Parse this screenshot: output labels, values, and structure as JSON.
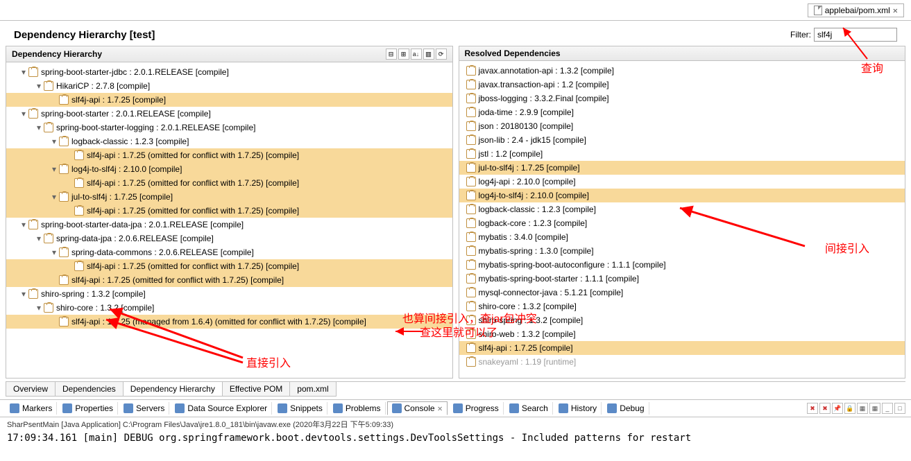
{
  "tab": {
    "label": "applebai/pom.xml",
    "close": "✕"
  },
  "page_title": "Dependency Hierarchy [test]",
  "filter": {
    "label": "Filter:",
    "value": "slf4j"
  },
  "left": {
    "title": "Dependency Hierarchy",
    "tree": [
      {
        "indent": 0,
        "twisty": "▾",
        "text": "spring-boot-starter-jdbc : 2.0.1.RELEASE [compile]",
        "hl": false
      },
      {
        "indent": 1,
        "twisty": "▾",
        "text": "HikariCP : 2.7.8 [compile]",
        "hl": false
      },
      {
        "indent": 2,
        "twisty": "",
        "text": "slf4j-api : 1.7.25 [compile]",
        "hl": true
      },
      {
        "indent": 0,
        "twisty": "▾",
        "text": "spring-boot-starter : 2.0.1.RELEASE [compile]",
        "hl": false
      },
      {
        "indent": 1,
        "twisty": "▾",
        "text": "spring-boot-starter-logging : 2.0.1.RELEASE [compile]",
        "hl": false
      },
      {
        "indent": 2,
        "twisty": "▾",
        "text": "logback-classic : 1.2.3 [compile]",
        "hl": false
      },
      {
        "indent": 3,
        "twisty": "",
        "text": "slf4j-api : 1.7.25 (omitted for conflict with 1.7.25) [compile]",
        "hl": true
      },
      {
        "indent": 2,
        "twisty": "▾",
        "text": "log4j-to-slf4j : 2.10.0 [compile]",
        "hl": true
      },
      {
        "indent": 3,
        "twisty": "",
        "text": "slf4j-api : 1.7.25 (omitted for conflict with 1.7.25) [compile]",
        "hl": true
      },
      {
        "indent": 2,
        "twisty": "▾",
        "text": "jul-to-slf4j : 1.7.25 [compile]",
        "hl": true
      },
      {
        "indent": 3,
        "twisty": "",
        "text": "slf4j-api : 1.7.25 (omitted for conflict with 1.7.25) [compile]",
        "hl": true
      },
      {
        "indent": 0,
        "twisty": "▾",
        "text": "spring-boot-starter-data-jpa : 2.0.1.RELEASE [compile]",
        "hl": false
      },
      {
        "indent": 1,
        "twisty": "▾",
        "text": "spring-data-jpa : 2.0.6.RELEASE [compile]",
        "hl": false
      },
      {
        "indent": 2,
        "twisty": "▾",
        "text": "spring-data-commons : 2.0.6.RELEASE [compile]",
        "hl": false
      },
      {
        "indent": 3,
        "twisty": "",
        "text": "slf4j-api : 1.7.25 (omitted for conflict with 1.7.25) [compile]",
        "hl": true
      },
      {
        "indent": 2,
        "twisty": "",
        "text": "slf4j-api : 1.7.25 (omitted for conflict with 1.7.25) [compile]",
        "hl": true
      },
      {
        "indent": 0,
        "twisty": "▾",
        "text": "shiro-spring : 1.3.2 [compile]",
        "hl": false
      },
      {
        "indent": 1,
        "twisty": "▾",
        "text": "shiro-core : 1.3.2 [compile]",
        "hl": false
      },
      {
        "indent": 2,
        "twisty": "",
        "text": "slf4j-api : 1.7.25 (managed from 1.6.4) (omitted for conflict with 1.7.25) [compile]",
        "hl": true
      }
    ]
  },
  "right": {
    "title": "Resolved Dependencies",
    "items": [
      {
        "text": "javax.annotation-api : 1.3.2 [compile]",
        "hl": false
      },
      {
        "text": "javax.transaction-api : 1.2 [compile]",
        "hl": false
      },
      {
        "text": "jboss-logging : 3.3.2.Final [compile]",
        "hl": false
      },
      {
        "text": "joda-time : 2.9.9 [compile]",
        "hl": false
      },
      {
        "text": "json : 20180130 [compile]",
        "hl": false
      },
      {
        "text": "json-lib : 2.4 - jdk15 [compile]",
        "hl": false
      },
      {
        "text": "jstl : 1.2 [compile]",
        "hl": false
      },
      {
        "text": "jul-to-slf4j : 1.7.25 [compile]",
        "hl": true
      },
      {
        "text": "log4j-api : 2.10.0 [compile]",
        "hl": false
      },
      {
        "text": "log4j-to-slf4j : 2.10.0 [compile]",
        "hl": true
      },
      {
        "text": "logback-classic : 1.2.3 [compile]",
        "hl": false
      },
      {
        "text": "logback-core : 1.2.3 [compile]",
        "hl": false
      },
      {
        "text": "mybatis : 3.4.0 [compile]",
        "hl": false
      },
      {
        "text": "mybatis-spring : 1.3.0 [compile]",
        "hl": false
      },
      {
        "text": "mybatis-spring-boot-autoconfigure : 1.1.1 [compile]",
        "hl": false
      },
      {
        "text": "mybatis-spring-boot-starter : 1.1.1 [compile]",
        "hl": false
      },
      {
        "text": "mysql-connector-java : 5.1.21 [compile]",
        "hl": false
      },
      {
        "text": "shiro-core : 1.3.2 [compile]",
        "hl": false
      },
      {
        "text": "shiro-spring : 1.3.2 [compile]",
        "hl": false
      },
      {
        "text": "shiro-web : 1.3.2 [compile]",
        "hl": false
      },
      {
        "text": "slf4j-api : 1.7.25 [compile]",
        "hl": true
      },
      {
        "text": "snakeyaml : 1.19 [runtime]",
        "hl": false,
        "gray": true
      }
    ]
  },
  "bottom_tabs": [
    "Overview",
    "Dependencies",
    "Dependency Hierarchy",
    "Effective POM",
    "pom.xml"
  ],
  "bottom_active": 2,
  "views": [
    "Markers",
    "Properties",
    "Servers",
    "Data Source Explorer",
    "Snippets",
    "Problems",
    "Console",
    "Progress",
    "Search",
    "History",
    "Debug"
  ],
  "views_active": 6,
  "status": "SharPsentMain [Java Application] C:\\Program Files\\Java\\jre1.8.0_181\\bin\\javaw.exe (2020年3月22日 下午5:09:33)",
  "console": "17:09:34.161 [main] DEBUG org.springframework.boot.devtools.settings.DevToolsSettings - Included patterns for restart",
  "annotations": {
    "query": "查询",
    "indirect": "间接引入",
    "direct": "直接引入",
    "note1": "也算间接引入，查jar包冲突",
    "note2": "查这里就可以了"
  }
}
